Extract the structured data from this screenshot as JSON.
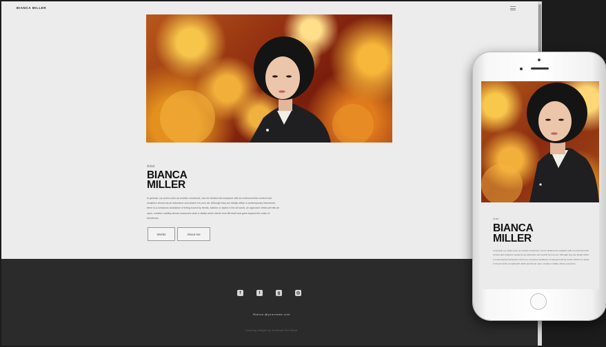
{
  "site": {
    "brand": "BIANCA MILLER",
    "role": "Artist",
    "name_line1": "BIANCA",
    "name_line2": "MILLER",
    "bio": "In general, my works seen as creative constructs, can be divided into sculpture with an environmental context and sculpture viewed as an adventure and search for pure art. Although they are ideally within a contemporary framework, there is a conscious avoidance of being bound by trends, fashion or styles in the art world, an approach which permits an open, creative mobility whose resources store  a vitality which stems from life itself and goes beyond the realm of trendiness.",
    "buttons": {
      "works": "Works",
      "about": "About me"
    }
  },
  "footer": {
    "social": [
      {
        "icon": "facebook-icon",
        "glyph": "f"
      },
      {
        "icon": "twitter-icon",
        "glyph": "t"
      },
      {
        "icon": "google-plus-icon",
        "glyph": "g"
      },
      {
        "icon": "instagram-icon",
        "glyph": "◎"
      }
    ],
    "email": "Bianca @yourname.com",
    "credit": "Amazing images by Jonathan Eve Wood"
  },
  "mobile": {
    "role": "Artist",
    "name_line1": "BIANCA",
    "name_line2": "MILLER",
    "bio": "In general, my works seen as creative constructs, can be divided into sculpture with an environmental context and sculpture viewed as an adventure and search for pure art. Although they are ideally within a contemporary framework, there is a conscious avoidance of being bound by trends, fashion or styles in the art world, an approach which permits an open, creative mobility, whose resources"
  },
  "colors": {
    "page_bg": "#ececec",
    "footer_bg": "#2b2b2b",
    "outer_bg": "#1c1c1c"
  }
}
